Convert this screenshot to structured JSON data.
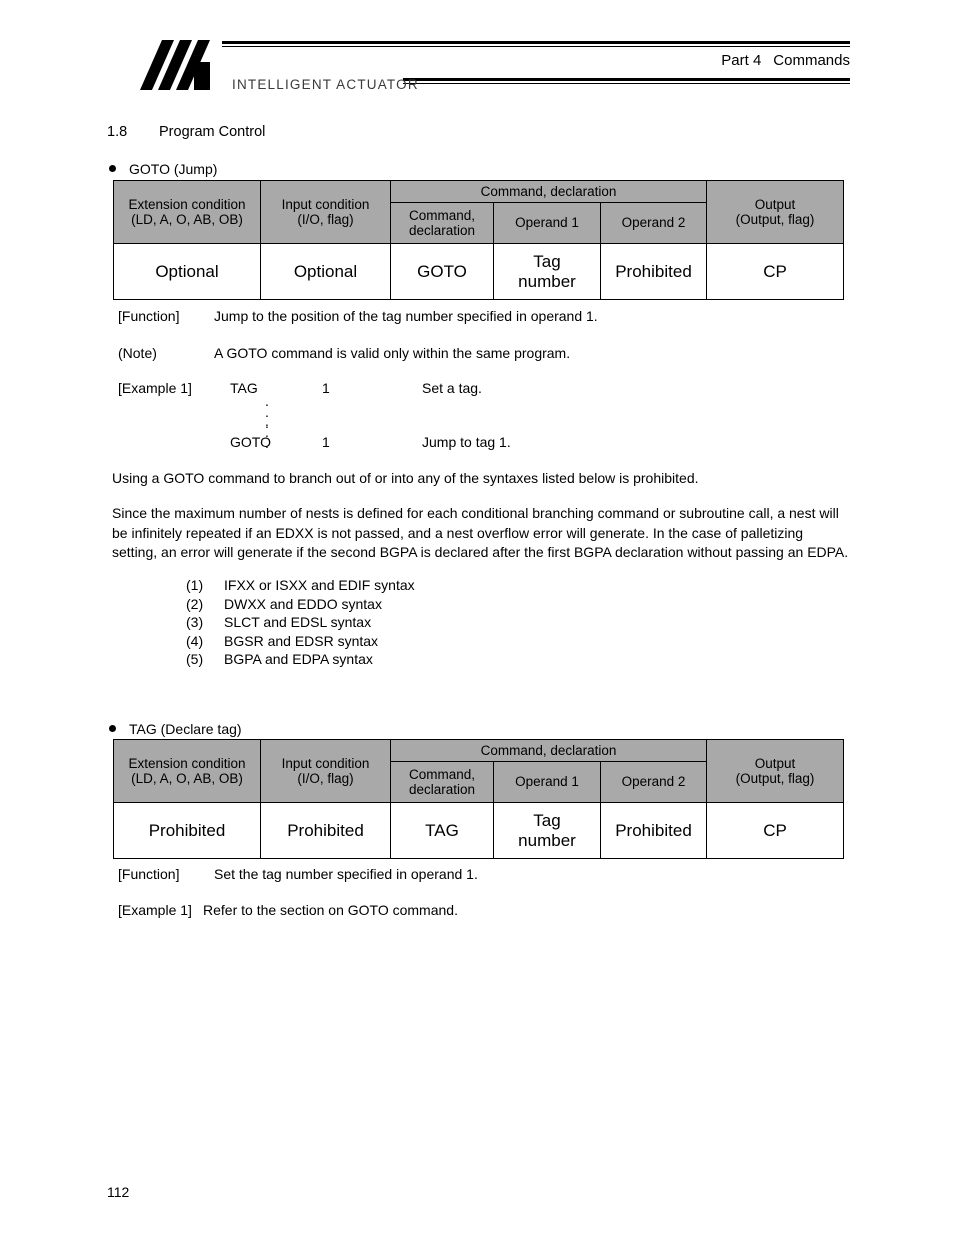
{
  "header": {
    "logo_wordmark": "INTELLIGENT ACTUATOR",
    "part": "Part 4",
    "title": "Commands"
  },
  "section": {
    "number": "1.8",
    "title": "Program Control"
  },
  "goto_block": {
    "heading": "GOTO (Jump)",
    "table": {
      "group_header": "Command, declaration",
      "columns": [
        {
          "line1": "Extension condition",
          "line2": "(LD, A, O, AB, OB)"
        },
        {
          "line1": "Input condition",
          "line2": "(I/O, flag)"
        },
        {
          "line1": "Command,",
          "line2": "declaration"
        },
        {
          "line1": "Operand 1",
          "line2": ""
        },
        {
          "line1": "Operand 2",
          "line2": ""
        },
        {
          "line1": "Output",
          "line2": "(Output, flag)"
        }
      ],
      "row": [
        {
          "line1": "Optional",
          "line2": ""
        },
        {
          "line1": "Optional",
          "line2": ""
        },
        {
          "line1": "GOTO",
          "line2": ""
        },
        {
          "line1": "Tag",
          "line2": "number"
        },
        {
          "line1": "Prohibited",
          "line2": ""
        },
        {
          "line1": "CP",
          "line2": ""
        }
      ]
    },
    "function_label": "[Function]",
    "function_text": "Jump to the position of the tag number specified in operand 1.",
    "note_label": "(Note)",
    "note_text": "A GOTO command is valid only within the same program.",
    "example_label": "[Example 1]",
    "example_rows": [
      {
        "command": "TAG",
        "operand": "1",
        "comment": "Set a tag."
      },
      {
        "command": "GOTO",
        "operand": "1",
        "comment": "Jump to tag 1."
      }
    ],
    "dots": "⋮",
    "prohibition_text": "Using a GOTO command to branch out of or into any of the syntaxes listed below is prohibited.",
    "nest_paragraph": "Since the maximum number of nests is defined for each conditional branching command or subroutine call, a nest will be infinitely repeated if an EDXX is not passed, and a nest overflow error will generate. In the case of palletizing setting, an error will generate if the second BGPA is declared after the first BGPA declaration without passing an EDPA.",
    "syntax_list": [
      {
        "num": "(1)",
        "text": "IFXX or ISXX and EDIF syntax"
      },
      {
        "num": "(2)",
        "text": "DWXX and EDDO syntax"
      },
      {
        "num": "(3)",
        "text": "SLCT and EDSL syntax"
      },
      {
        "num": "(4)",
        "text": "BGSR and EDSR syntax"
      },
      {
        "num": "(5)",
        "text": "BGPA and EDPA syntax"
      }
    ]
  },
  "tag_block": {
    "heading": "TAG (Declare tag)",
    "table": {
      "group_header": "Command, declaration",
      "columns": [
        {
          "line1": "Extension condition",
          "line2": "(LD, A, O, AB, OB)"
        },
        {
          "line1": "Input condition",
          "line2": "(I/O, flag)"
        },
        {
          "line1": "Command,",
          "line2": "declaration"
        },
        {
          "line1": "Operand 1",
          "line2": ""
        },
        {
          "line1": "Operand 2",
          "line2": ""
        },
        {
          "line1": "Output",
          "line2": "(Output, flag)"
        }
      ],
      "row": [
        {
          "line1": "Prohibited",
          "line2": ""
        },
        {
          "line1": "Prohibited",
          "line2": ""
        },
        {
          "line1": "TAG",
          "line2": ""
        },
        {
          "line1": "Tag",
          "line2": "number"
        },
        {
          "line1": "Prohibited",
          "line2": ""
        },
        {
          "line1": "CP",
          "line2": ""
        }
      ]
    },
    "function_label": "[Function]",
    "function_text": "Set the tag number specified in operand 1.",
    "example_label": "[Example 1]",
    "example_text": "Refer to the section on GOTO command."
  },
  "footer": {
    "page_number": "112"
  }
}
